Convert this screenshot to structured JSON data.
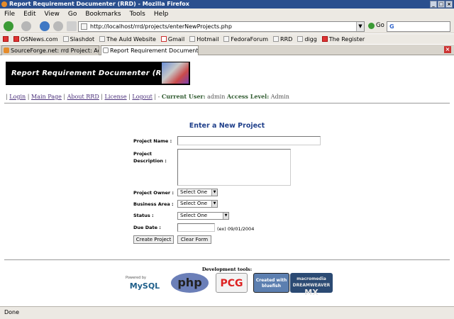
{
  "window": {
    "title": "Report Requirement Documenter (RRD) - Mozilla Firefox"
  },
  "menu": {
    "items": [
      "File",
      "Edit",
      "View",
      "Go",
      "Bookmarks",
      "Tools",
      "Help"
    ]
  },
  "toolbar": {
    "url": "http://localhost/rrd/projects/enterNewProjects.php",
    "go_label": "Go",
    "search_value": "G"
  },
  "bookmarks": [
    "OSNews.com",
    "Slashdot",
    "The Auld Website",
    "Gmail",
    "Hotmail",
    "FedoraForum",
    "RRD",
    "digg",
    "The Register"
  ],
  "tabs": [
    {
      "label": "SourceForge.net: rrd Project: Admin..."
    },
    {
      "label": "Report Requirement Documenter..."
    }
  ],
  "page": {
    "banner_title": "Report Requirement Documenter (RRD)",
    "nav": {
      "login": "Login",
      "main_page": "Main Page",
      "about": "About RRD",
      "license": "License",
      "logout": "Logout",
      "current_user_label": "Current User:",
      "current_user": "admin",
      "access_level_label": "Access Level:",
      "access_level": "Admin"
    },
    "form": {
      "title": "Enter a New Project",
      "project_name_label": "Project Name :",
      "project_name_value": "",
      "description_label": "Project Description :",
      "description_value": "",
      "owner_label": "Project Owner :",
      "owner_value": "Select One",
      "business_area_label": "Business Area :",
      "business_area_value": "Select One",
      "status_label": "Status :",
      "status_value": "Select One",
      "due_date_label": "Due Date :",
      "due_date_value": "",
      "due_date_hint": "(ex) 09/01/2004",
      "create_button": "Create Project",
      "clear_button": "Clear Form"
    },
    "footer": {
      "dev_tools_label": "Development tools:",
      "badges": {
        "mysql_top": "Powered by",
        "mysql": "MySQL",
        "php": "php",
        "pcg": "PCG",
        "bluefish_top": "Created with",
        "bluefish": "bluefish",
        "mx_top": "macromedia DREAMWEAVER",
        "mx": "MX"
      }
    }
  },
  "status": {
    "text": "Done"
  }
}
